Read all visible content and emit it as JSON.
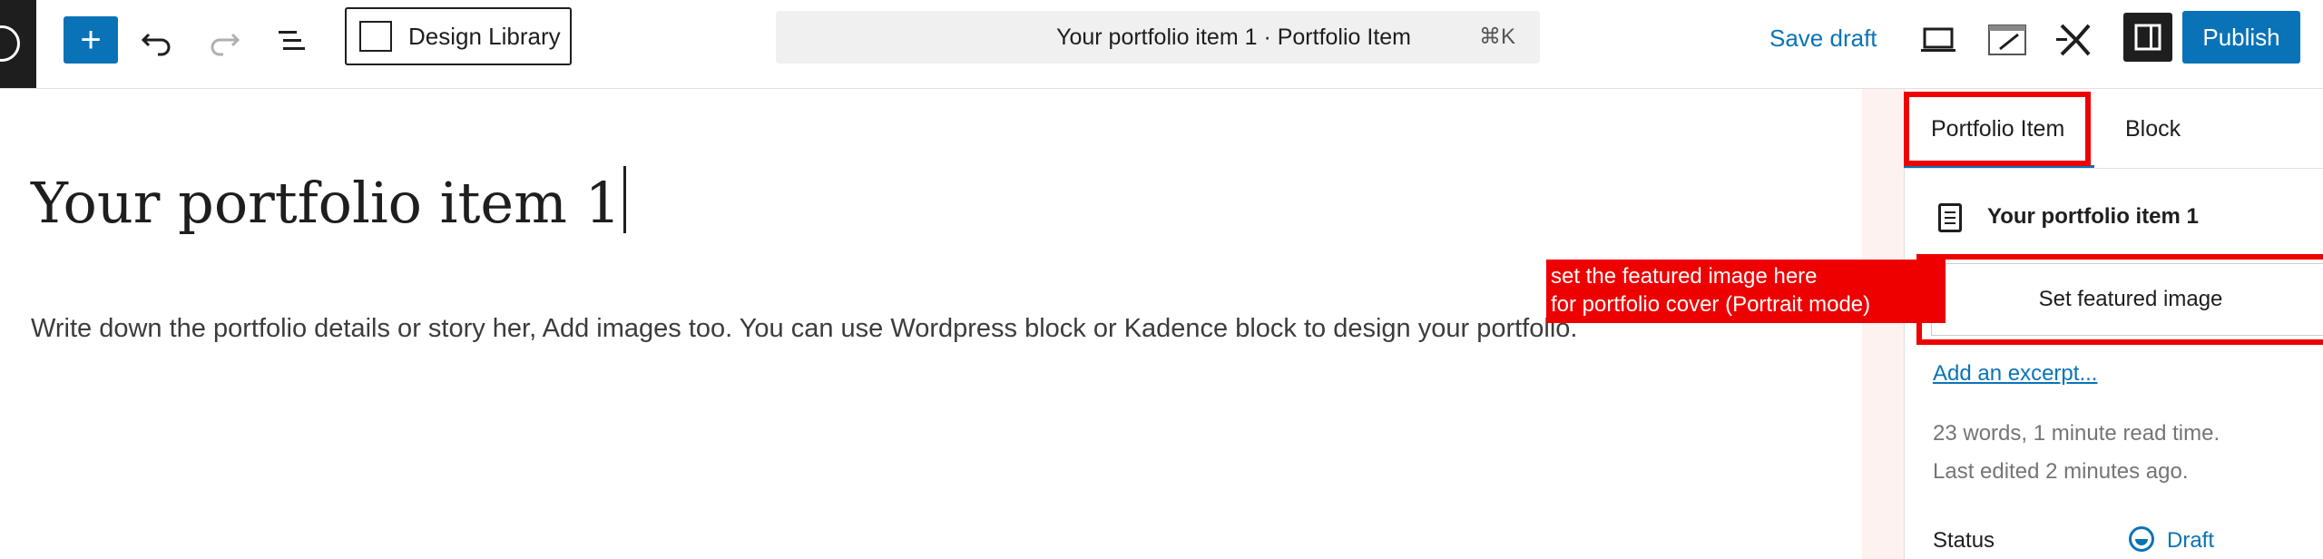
{
  "toolbar": {
    "design_library_label": "Design Library",
    "command_title": "Your portfolio item 1 · Portfolio Item",
    "command_shortcut": "⌘K",
    "save_draft_label": "Save draft",
    "publish_label": "Publish",
    "add_block_symbol": "+"
  },
  "editor": {
    "post_title": "Your portfolio item 1",
    "post_body": "Write down the portfolio details or story her, Add images too. You can use Wordpress block or Kadence block to design your portfolio."
  },
  "sidebar": {
    "tabs": [
      {
        "label": "Portfolio Item",
        "active": true
      },
      {
        "label": "Block",
        "active": false
      }
    ],
    "post_name": "Your portfolio item 1",
    "featured_image_button": "Set featured image",
    "excerpt_link": "Add an excerpt...",
    "meta_read_time": "23 words, 1 minute read time.",
    "meta_last_edited": "Last edited 2 minutes ago.",
    "status_label": "Status",
    "status_value": "Draft"
  },
  "annotation": {
    "line1": "set the featured image here",
    "line2": "for portfolio cover (Portrait mode)",
    "color": "#ee0000"
  },
  "colors": {
    "accent": "#0a73b7",
    "dark": "#1e1e1e",
    "highlight": "#ee0000"
  },
  "icons": [
    "wordpress-icon",
    "undo-icon",
    "redo-icon",
    "list-view-icon",
    "kadence-icon",
    "preview-icon",
    "editor-icon",
    "kadence-logo-icon",
    "sidebar-toggle-icon",
    "document-icon",
    "draft-status-icon"
  ]
}
